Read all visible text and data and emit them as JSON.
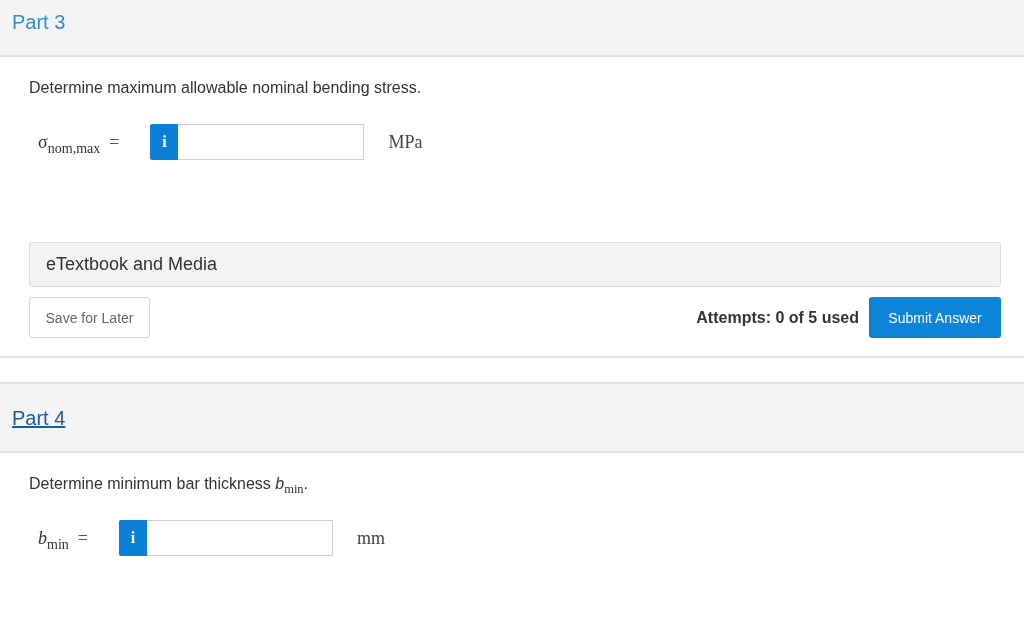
{
  "parts": [
    {
      "title": {
        "text": "Part 3",
        "hovered": false
      },
      "question": "Determine maximum allowable nominal bending stress.",
      "answer": {
        "variable": "σ$_{nom,max}$",
        "equals": "=",
        "info": "i",
        "unit": "MPa"
      },
      "resources": {
        "label": "eTextbook and Media"
      },
      "actions": {
        "save": "Save for Later",
        "attempts": "Attempts: 0 of 5 used",
        "submit": "Submit Answer"
      }
    },
    {
      "title": {
        "text": "Part 4",
        "hovered": true
      },
      "question": "Determine minimum bar thickness *b*$_{min}$.",
      "answer": {
        "variable": "*b*$_{min}$",
        "equals": "=",
        "info": "i",
        "unit": "mm"
      }
    }
  ]
}
